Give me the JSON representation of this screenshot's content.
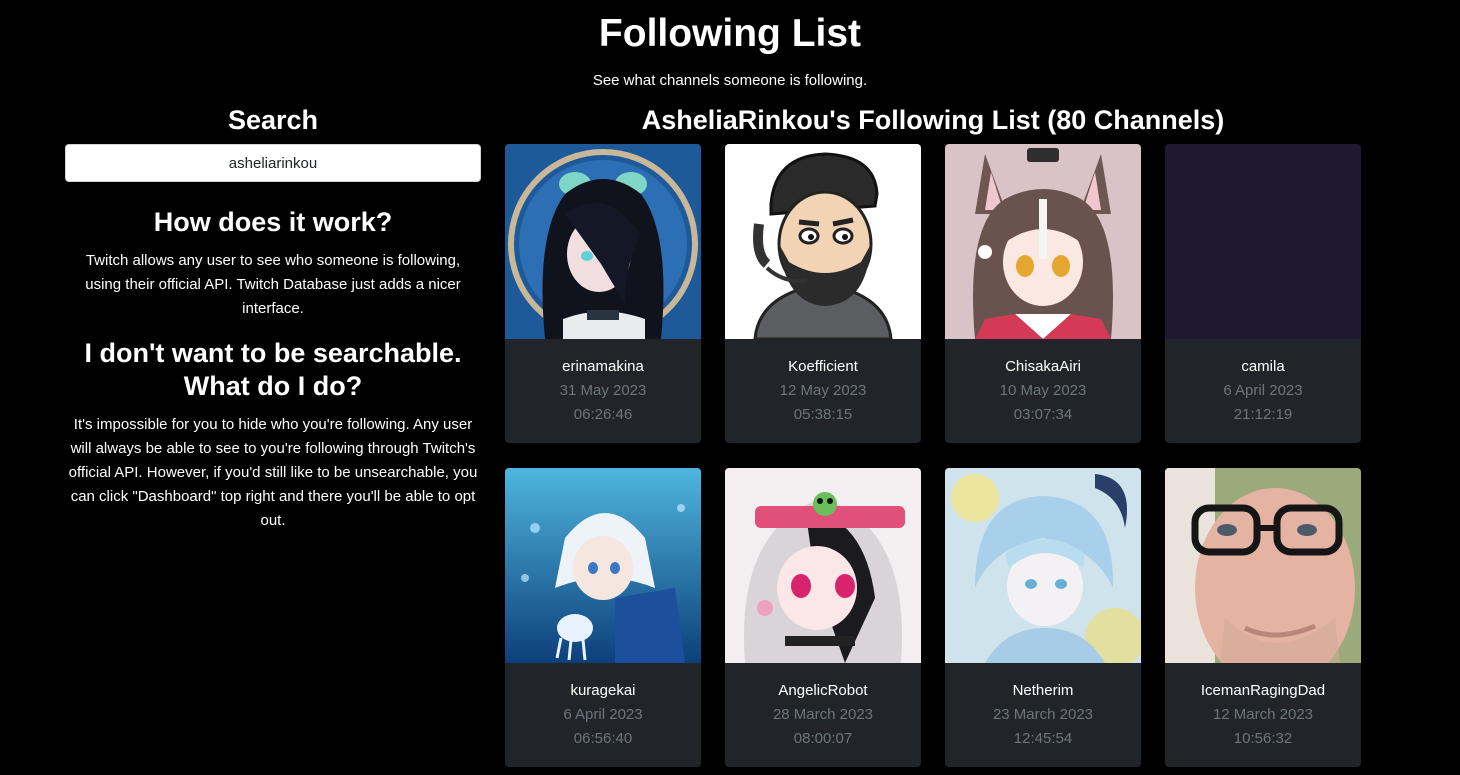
{
  "header": {
    "title": "Following List",
    "subtitle": "See what channels someone is following."
  },
  "sidebar": {
    "search_heading": "Search",
    "search_value": "asheliarinkou",
    "faq": [
      {
        "question": "How does it work?",
        "answer": "Twitch allows any user to see who someone is following, using their official API. Twitch Database just adds a nicer interface."
      },
      {
        "question": "I don't want to be searchable. What do I do?",
        "answer": "It's impossible for you to hide who you're following. Any user will always be able to see to you're following through Twitch's official API. However, if you'd still like to be unsearchable, you can click \"Dashboard\" top right and there you'll be able to opt out."
      }
    ]
  },
  "main": {
    "list_heading": "AsheliaRinkou's Following List (80 Channels)",
    "channels": [
      {
        "name": "erinamakina",
        "date": "31 May 2023",
        "time": "06:26:46",
        "avatar": "anime-dark-hair-avatar"
      },
      {
        "name": "Koefficient",
        "date": "12 May 2023",
        "time": "05:38:15",
        "avatar": "bearded-cartoon-avatar"
      },
      {
        "name": "ChisakaAiri",
        "date": "10 May 2023",
        "time": "03:07:34",
        "avatar": "anime-fox-ears-avatar"
      },
      {
        "name": "camila",
        "date": "6 April 2023",
        "time": "21:12:19",
        "avatar": "purple-placeholder-avatar"
      },
      {
        "name": "kuragekai",
        "date": "6 April 2023",
        "time": "06:56:40",
        "avatar": "anime-underwater-avatar"
      },
      {
        "name": "AngelicRobot",
        "date": "28 March 2023",
        "time": "08:00:07",
        "avatar": "anime-pink-visor-avatar"
      },
      {
        "name": "Netherim",
        "date": "23 March 2023",
        "time": "12:45:54",
        "avatar": "anime-light-blue-avatar"
      },
      {
        "name": "IcemanRagingDad",
        "date": "12 March 2023",
        "time": "10:56:32",
        "avatar": "man-glasses-photo-avatar"
      }
    ]
  },
  "colors": {
    "background": "#000000",
    "card": "#212529",
    "muted_text": "#6c757d"
  }
}
